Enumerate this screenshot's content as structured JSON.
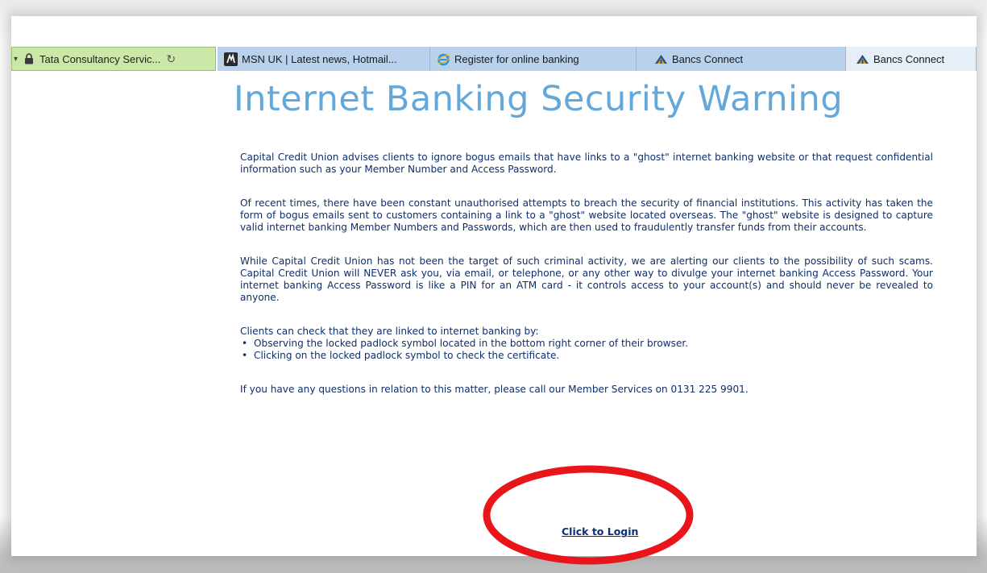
{
  "browser": {
    "address_tab": {
      "site": "Tata Consultancy Servic...",
      "refresh_glyph": "↻",
      "dropdown_glyph": "▾"
    },
    "tabs": [
      {
        "label": "MSN UK | Latest news, Hotmail...",
        "icon": "msn-icon",
        "active": false
      },
      {
        "label": "Register for online banking",
        "icon": "ie-icon",
        "active": false
      },
      {
        "label": "Bancs Connect",
        "icon": "bancs-icon",
        "active": false
      },
      {
        "label": "Bancs Connect",
        "icon": "bancs-icon",
        "active": true
      }
    ]
  },
  "page": {
    "title": "Internet Banking Security Warning",
    "paragraphs": [
      "Capital Credit Union advises clients to ignore bogus emails that have links to a \"ghost\" internet banking website or that request confidential information such as your Member Number and Access Password.",
      "Of recent times, there have been constant unauthorised attempts to breach the security of financial institutions. This activity has taken the form of bogus emails sent to customers containing a link to a \"ghost\" website located overseas. The \"ghost\" website is designed to capture valid internet banking Member Numbers and Passwords, which are then used to fraudulently transfer funds from their accounts.",
      "While Capital Credit Union has not been the target of such criminal activity, we are alerting our clients to the possibility of such scams. Capital Credit Union will NEVER ask you, via email, or telephone, or any other way to divulge your internet banking Access Password. Your internet banking Access Password is like a PIN for an ATM card - it controls access to your account(s) and should never be revealed to anyone."
    ],
    "checks_intro": "Clients can check that they are linked to internet banking by:",
    "checks": [
      "Observing the locked padlock symbol located in the bottom right corner of their browser.",
      "Clicking on the locked padlock symbol to check the certificate."
    ],
    "bullet": "•",
    "contact": "If you have any questions in relation to this matter, please call our Member Services on 0131 225 9901.",
    "login_link": "Click to Login"
  },
  "colors": {
    "heading": "#63a8d8",
    "body_text": "#0f2f6a",
    "address_tab": "#cbe8a8",
    "tab": "#b9d1ea",
    "annotation": "#e8161b"
  }
}
